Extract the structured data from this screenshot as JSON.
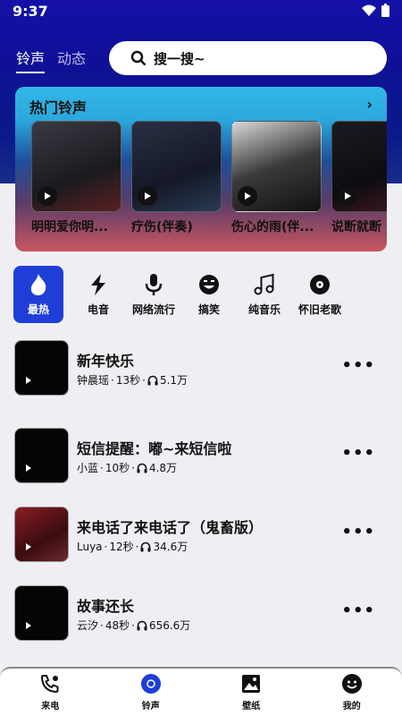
{
  "status": {
    "time": "9:37"
  },
  "top_tabs": [
    {
      "label": "铃声",
      "active": true
    },
    {
      "label": "动态",
      "active": false
    }
  ],
  "search": {
    "placeholder": "搜一搜~"
  },
  "hot": {
    "title": "热门铃声",
    "items": [
      {
        "title": "明明爱你明...",
        "thumb_color": "#2b2b33"
      },
      {
        "title": "疗伤(伴奏)",
        "thumb_color": "#1e2433"
      },
      {
        "title": "伤心的雨(伴...",
        "thumb_color": "#2a2a2a"
      },
      {
        "title": "说断就断",
        "thumb_color": "#1a1a22"
      }
    ]
  },
  "categories": [
    {
      "label": "最热",
      "icon": "flame-icon",
      "selected": true
    },
    {
      "label": "电音",
      "icon": "lightning-icon",
      "selected": false
    },
    {
      "label": "网络流行",
      "icon": "microphone-icon",
      "selected": false
    },
    {
      "label": "搞笑",
      "icon": "laugh-face-icon",
      "selected": false
    },
    {
      "label": "纯音乐",
      "icon": "music-notes-icon",
      "selected": false
    },
    {
      "label": "怀旧老歌",
      "icon": "vinyl-record-icon",
      "selected": false
    }
  ],
  "songs": [
    {
      "title": "新年快乐",
      "artist": "钟晨瑶",
      "duration": "13秒",
      "plays": "5.1万"
    },
    {
      "title": "短信提醒：嘟~来短信啦",
      "artist": "小蓝",
      "duration": "10秒",
      "plays": "4.8万"
    },
    {
      "title": "来电话了来电话了（鬼畜版）",
      "artist": "Luya",
      "duration": "12秒",
      "plays": "34.6万"
    },
    {
      "title": "故事还长",
      "artist": "云汐",
      "duration": "48秒",
      "plays": "656.6万"
    }
  ],
  "bottom_nav": [
    {
      "label": "来电",
      "icon": "phone-icon",
      "active": false
    },
    {
      "label": "铃声",
      "icon": "ringtone-disc-icon",
      "active": true
    },
    {
      "label": "壁纸",
      "icon": "image-icon",
      "active": false
    },
    {
      "label": "我的",
      "icon": "profile-face-icon",
      "active": false
    }
  ],
  "colors": {
    "accent": "#1f3ed8",
    "header": "#1410a8"
  }
}
